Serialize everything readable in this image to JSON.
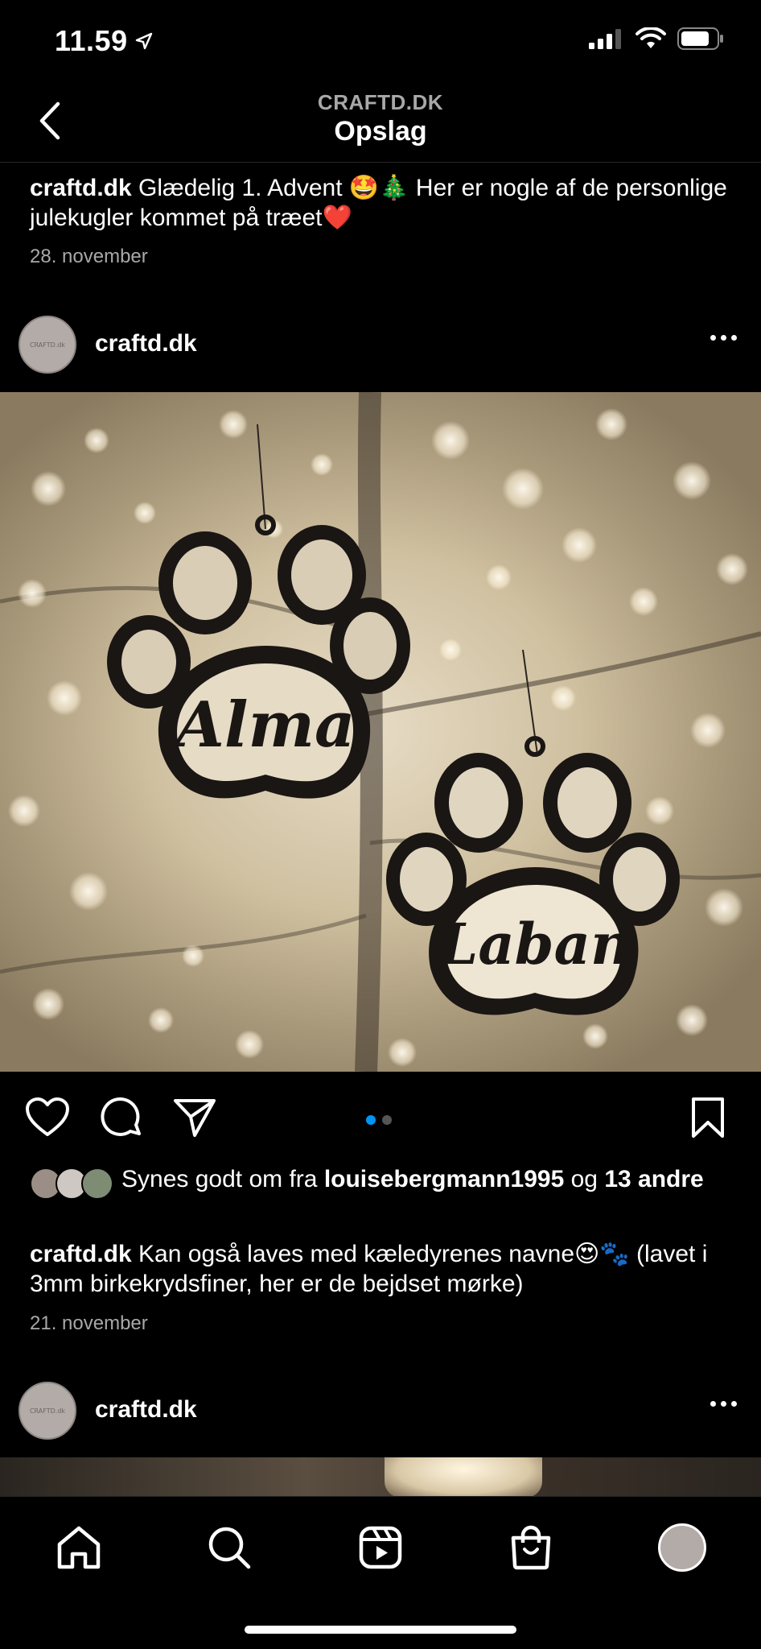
{
  "status_bar": {
    "time": "11.59"
  },
  "nav": {
    "account": "CRAFTD.DK",
    "title": "Opslag"
  },
  "prev_post": {
    "username": "craftd.dk",
    "caption": "Glædelig 1. Advent 🤩🎄 Her er nogle af de personlige julekugler kommet på træet❤️",
    "date": "28. november"
  },
  "post": {
    "username": "craftd.dk",
    "avatar_text": "CRAFTD.dk",
    "image_alt": "Black wooden paw-print ornaments with names Alma and Laban hanging on a lit tree",
    "ornament_names": [
      "Alma",
      "Laban"
    ],
    "carousel": {
      "count": 2,
      "active": 1
    },
    "likes": {
      "prefix": "Synes godt om fra",
      "user": "louisebergmann1995",
      "joiner": "og",
      "others": "13 andre"
    },
    "caption_user": "craftd.dk",
    "caption": "Kan også laves med kæledyrenes navne😍🐾 (lavet i 3mm birkekrydsfiner, her er de bejdset mørke)",
    "date": "21. november"
  },
  "next_post": {
    "username": "craftd.dk",
    "avatar_text": "CRAFTD.dk"
  },
  "icons": {
    "back": "chevron-left-icon",
    "like": "heart-icon",
    "comment": "comment-icon",
    "share": "send-icon",
    "save": "bookmark-icon",
    "more": "more-horizontal-icon"
  },
  "colors": {
    "background": "#000000",
    "secondary_text": "#a8a8a8",
    "accent": "#0095f6"
  }
}
